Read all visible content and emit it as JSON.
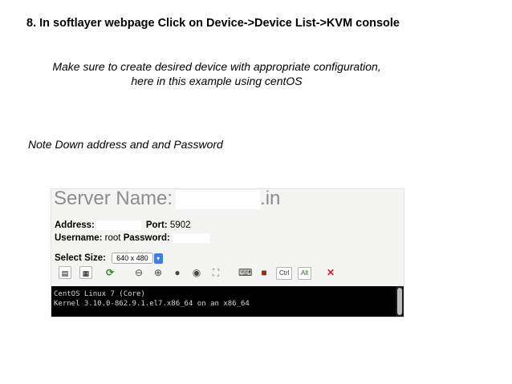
{
  "slide": {
    "heading": "8. In softlayer webpage Click on Device->Device List->KVM console",
    "note_line1": "Make sure to create desired device with appropriate configuration,",
    "note_line2": "here in this example using centOS",
    "note_credentials": "Note Down address and and Password"
  },
  "kvm": {
    "server_label": "Server Name:",
    "server_suffix": ".in",
    "address_label": "Address:",
    "port_label": "Port:",
    "port_value": "5902",
    "username_label": "Username:",
    "username_value": "root",
    "password_label": "Password:",
    "select_size_label": "Select Size:",
    "select_size_value": "640 x 480",
    "toolbar_ctrl": "Ctrl",
    "toolbar_alt": "Alt",
    "console_lines": [
      "CentOS Linux 7 (Core)",
      "Kernel 3.10.0-862.9.1.el7.x86_64 on an x86_64"
    ]
  },
  "icons": [
    "clipboard-icon",
    "paste-icon",
    "refresh-icon",
    "zoom-out-icon",
    "zoom-in-icon",
    "zoom-fit-icon",
    "zoom-reset-icon",
    "fullscreen-icon",
    "keyboard-icon",
    "book-icon",
    "close-icon"
  ]
}
